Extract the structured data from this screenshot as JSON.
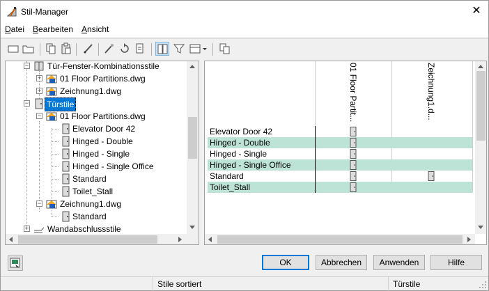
{
  "window": {
    "title": "Stil-Manager",
    "close_glyph": "✕"
  },
  "menu": [
    {
      "label_underlined": "D",
      "label_rest": "atei"
    },
    {
      "label_underlined": "B",
      "label_rest": "earbeiten"
    },
    {
      "label_underlined": "A",
      "label_rest": "nsicht"
    }
  ],
  "toolbar": {
    "icons": [
      "new-icon",
      "open-icon",
      "copy-icon",
      "paste-icon",
      "edit-icon",
      "purge-icon",
      "refresh-icon",
      "export-icon",
      "toggle-view-icon",
      "filter-icon",
      "view-menu-icon",
      "inventory-icon"
    ]
  },
  "tree": {
    "items": [
      {
        "label": "Tür-Fenster-Kombinationsstile",
        "icon": "combo-style-icon"
      },
      {
        "label": "01 Floor Partitions.dwg",
        "icon": "drawing-icon"
      },
      {
        "label": "Zeichnung1.dwg",
        "icon": "drawing-icon"
      },
      {
        "label": "Türstile",
        "icon": "door-style-icon"
      },
      {
        "label": "01 Floor Partitions.dwg",
        "icon": "drawing-icon"
      },
      {
        "label": "Elevator Door 42",
        "icon": "door-icon"
      },
      {
        "label": "Hinged - Double",
        "icon": "door-icon"
      },
      {
        "label": "Hinged - Single",
        "icon": "door-icon"
      },
      {
        "label": "Hinged - Single Office",
        "icon": "door-icon"
      },
      {
        "label": "Standard",
        "icon": "door-icon"
      },
      {
        "label": "Toilet_Stall",
        "icon": "door-icon"
      },
      {
        "label": "Zeichnung1.dwg",
        "icon": "drawing-icon"
      },
      {
        "label": "Standard",
        "icon": "door-icon"
      },
      {
        "label": "Wandabschlussstile",
        "icon": "endcap-style-icon"
      }
    ]
  },
  "grid": {
    "columns": [
      "01 Floor Partit...",
      "Zeichnung1.d..."
    ],
    "rows": [
      {
        "label": "Elevator Door 42",
        "in_col": [
          true,
          false
        ],
        "highlight": false
      },
      {
        "label": "Hinged - Double",
        "in_col": [
          true,
          false
        ],
        "highlight": true
      },
      {
        "label": "Hinged - Single",
        "in_col": [
          true,
          false
        ],
        "highlight": false
      },
      {
        "label": "Hinged - Single Office",
        "in_col": [
          true,
          false
        ],
        "highlight": true
      },
      {
        "label": "Standard",
        "in_col": [
          true,
          true
        ],
        "highlight": false
      },
      {
        "label": "Toilet_Stall",
        "in_col": [
          true,
          false
        ],
        "highlight": true
      }
    ],
    "highlight_color": "#bde3d6"
  },
  "buttons": {
    "ok": "OK",
    "cancel": "Abbrechen",
    "apply": "Anwenden",
    "help": "Hilfe"
  },
  "status": {
    "left": "Stile sortiert",
    "right": "Türstile"
  },
  "colors": {
    "selection": "#0078d7",
    "accent": "#0078d7"
  }
}
